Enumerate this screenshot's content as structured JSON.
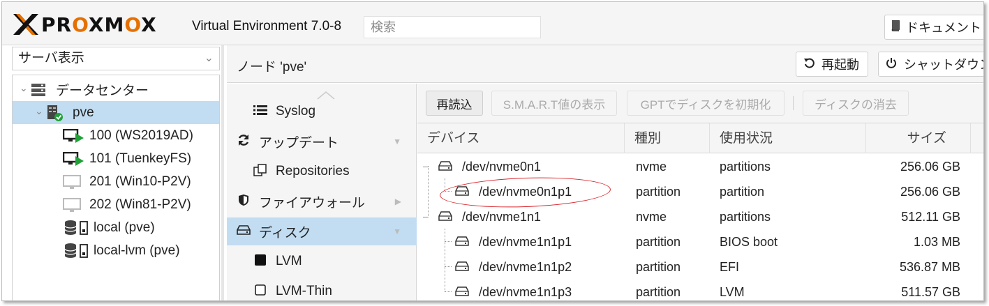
{
  "header": {
    "brand": "PROXMOX",
    "version": "Virtual Environment 7.0-8",
    "search_placeholder": "検索",
    "doc_button": "ドキュメント"
  },
  "left": {
    "view_select": "サーバ表示",
    "tree": [
      {
        "label": "データセンター",
        "icon": "datacenter-icon"
      },
      {
        "label": "pve",
        "icon": "node-online-icon",
        "selected": true
      },
      {
        "label": "100 (WS2019AD)",
        "icon": "vm-running-icon"
      },
      {
        "label": "101 (TuenkeyFS)",
        "icon": "vm-running-icon"
      },
      {
        "label": "201 (Win10-P2V)",
        "icon": "vm-stopped-icon"
      },
      {
        "label": "202 (Win81-P2V)",
        "icon": "vm-stopped-icon"
      },
      {
        "label": "local (pve)",
        "icon": "storage-icon"
      },
      {
        "label": "local-lvm (pve)",
        "icon": "storage-icon"
      }
    ]
  },
  "main": {
    "title": "ノード 'pve'",
    "reboot_button": "再起動",
    "shutdown_button": "シャットダウン",
    "submenu": [
      {
        "label": "Syslog",
        "icon": "list-icon"
      },
      {
        "label": "アップデート",
        "icon": "refresh-icon"
      },
      {
        "label": "Repositories",
        "icon": "repositories-icon"
      },
      {
        "label": "ファイアウォール",
        "icon": "shield-icon"
      },
      {
        "label": "ディスク",
        "icon": "disk-icon",
        "selected": true
      },
      {
        "label": "LVM",
        "icon": "lvm-icon"
      },
      {
        "label": "LVM-Thin",
        "icon": "lvm-thin-icon"
      }
    ],
    "toolbar": {
      "reload": "再読込",
      "smart": "S.M.A.R.T値の表示",
      "gpt": "GPTでディスクを初期化",
      "wipe": "ディスクの消去"
    },
    "columns": {
      "device": "デバイス",
      "type": "種別",
      "usage": "使用状況",
      "size": "サイズ"
    },
    "rows": [
      {
        "device": "/dev/nvme0n1",
        "type": "nvme",
        "usage": "partitions",
        "size": "256.06 GB"
      },
      {
        "device": "/dev/nvme0n1p1",
        "type": "partition",
        "usage": "partition",
        "size": "256.06 GB"
      },
      {
        "device": "/dev/nvme1n1",
        "type": "nvme",
        "usage": "partitions",
        "size": "512.11 GB"
      },
      {
        "device": "/dev/nvme1n1p1",
        "type": "partition",
        "usage": "BIOS boot",
        "size": "1.03 MB"
      },
      {
        "device": "/dev/nvme1n1p2",
        "type": "partition",
        "usage": "EFI",
        "size": "536.87 MB"
      },
      {
        "device": "/dev/nvme1n1p3",
        "type": "partition",
        "usage": "LVM",
        "size": "511.57 GB"
      }
    ]
  }
}
